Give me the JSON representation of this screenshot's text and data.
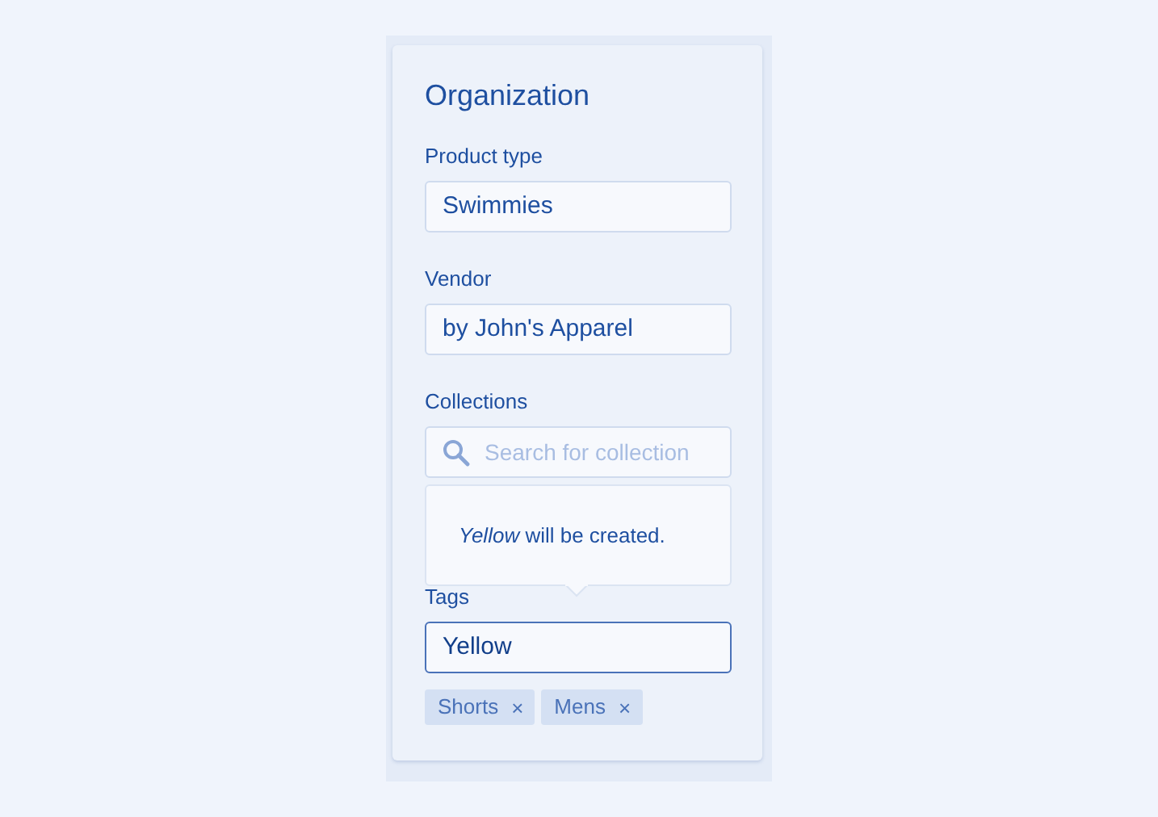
{
  "card": {
    "title": "Organization",
    "fields": [
      {
        "kind": "text",
        "label": "Product type",
        "value": "Swimmies",
        "focused": false
      },
      {
        "kind": "text",
        "label": "Vendor",
        "value": "by John's Apparel",
        "focused": false
      },
      {
        "kind": "search",
        "label": "Collections",
        "placeholder": "Search for collection",
        "focused": false
      },
      {
        "kind": "text",
        "label": "Tags",
        "value": "Yellow",
        "focused": true
      }
    ],
    "popover": {
      "message": "*Yellow* will be created."
    },
    "tags": [
      {
        "label": "Shorts",
        "remove": "×"
      },
      {
        "label": "Mens",
        "remove": "×"
      }
    ]
  }
}
